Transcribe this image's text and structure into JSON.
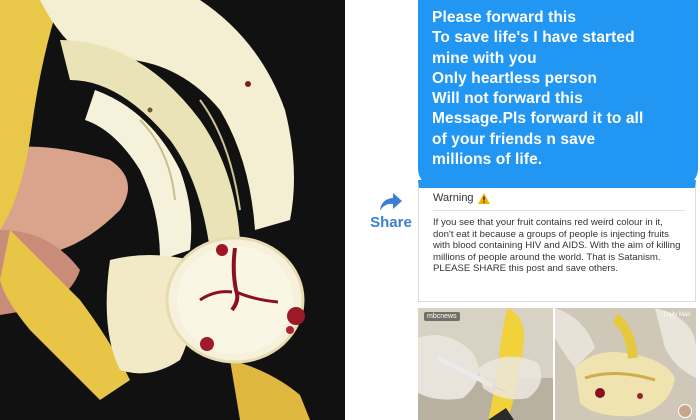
{
  "message": {
    "lines": [
      "Please forward this",
      "To save life's I have started",
      "mine with you",
      "Only heartless person",
      "Will not forward this",
      "Message.Pls forward it to all",
      "of your friends n save",
      "millions of life."
    ],
    "text": "Please forward this\nTo save life's I have started\nmine with you\nOnly heartless person\nWill not forward this\nMessage.Pls forward it to all\nof your friends n save\nmillions of life."
  },
  "share": {
    "label": "Share"
  },
  "post": {
    "warning_title": "Warning",
    "warning_body": "If you see that your fruit contains red weird colour in it, don't eat it because a groups of people is injecting fruits with blood containing HIV and AIDS. With the aim of killing millions of people around the world. That is Satanism. PLEASE SHARE this post and save others."
  },
  "images": {
    "logo_a": "mbcnews",
    "logo_b": "Daily Mail"
  },
  "colors": {
    "bubble": "#2196f3",
    "share": "#3b7fd4",
    "banana": "#f1d76a",
    "stain": "#8a1020"
  },
  "icons": {
    "share": "share-arrow-icon",
    "warning": "warning-triangle-icon"
  }
}
